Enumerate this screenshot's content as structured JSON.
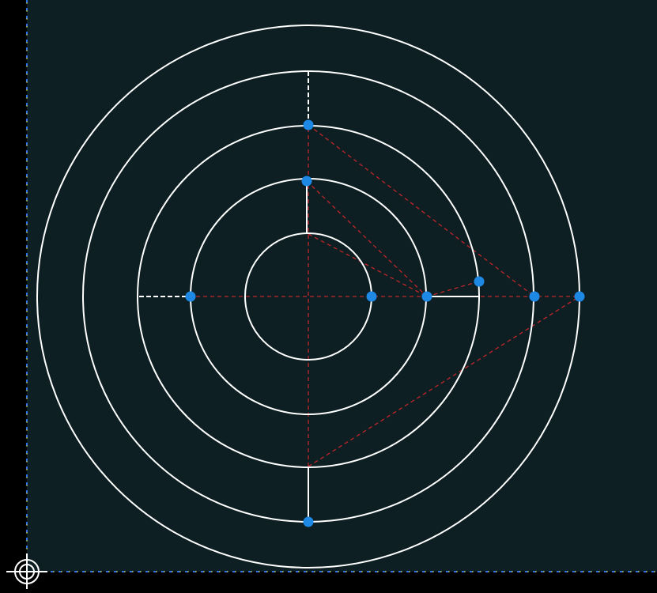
{
  "app": {
    "description_tag": "cad-sketch-viewport"
  },
  "colors": {
    "viewport_background": "#0d1f23",
    "outside_background": "#000000",
    "geometry": "#ffffff",
    "construction": "#c0262a",
    "point": "#1e88e5",
    "axis_vertical_primary": "#d4c84a",
    "axis_dash": "#2f6fe0",
    "axis_horizontal_primary": "#d4c84a",
    "origin_marker": "#ffffff"
  },
  "sketch": {
    "circles": 6,
    "points": 9,
    "construction_lines": 10
  }
}
